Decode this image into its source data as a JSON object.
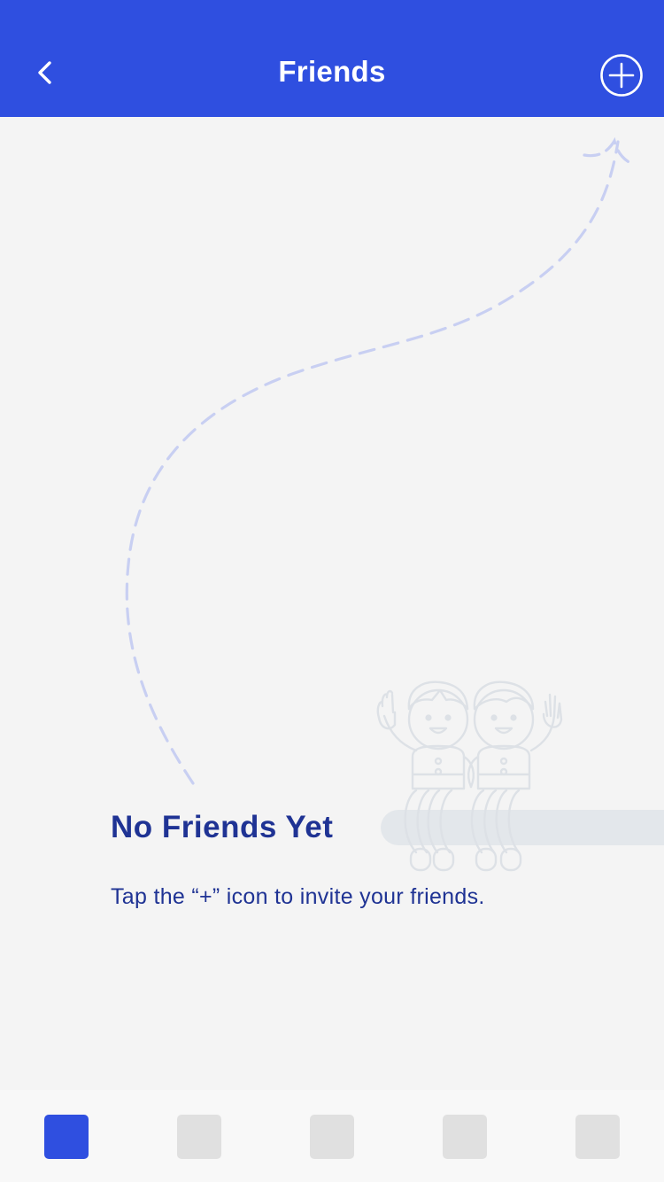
{
  "header": {
    "title": "Friends",
    "back_icon": "chevron-left-icon",
    "add_icon": "plus-circle-icon"
  },
  "empty_state": {
    "title": "No Friends Yet",
    "subtitle": "Tap the “+” icon to invite your friends.",
    "illustration": "two-friends-sitting-on-bar-illustration",
    "arrow": "dashed-arrow-to-add-button"
  },
  "tabbar": {
    "tabs": [
      {
        "icon": "tab-1-icon",
        "active": true
      },
      {
        "icon": "tab-2-icon",
        "active": false
      },
      {
        "icon": "tab-3-icon",
        "active": false
      },
      {
        "icon": "tab-4-icon",
        "active": false
      },
      {
        "icon": "tab-5-icon",
        "active": false
      }
    ]
  },
  "colors": {
    "brand": "#2f4fe0",
    "text_dark_blue": "#1f3394",
    "background": "#f4f4f4",
    "arrow": "#c8cff2",
    "illustration_stroke": "#dde1e6",
    "tab_inactive": "#e0e0e0"
  }
}
